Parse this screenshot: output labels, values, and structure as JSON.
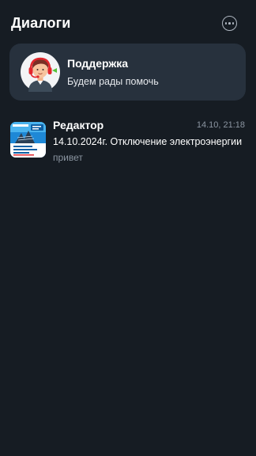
{
  "header": {
    "title": "Диалоги",
    "more_icon": "more-horizontal-circle-icon"
  },
  "support": {
    "title": "Поддержка",
    "subtitle": "Будем рады помочь",
    "avatar_icon": "support-agent-headset-icon"
  },
  "chats": [
    {
      "name": "Редактор",
      "time": "14.10, 21:18",
      "message": "14.10.2024г. Отключение электроэнергии",
      "preview": "привет",
      "avatar_icon": "news-thumbnail-image"
    }
  ],
  "colors": {
    "background": "#161c23",
    "card": "#27313d",
    "muted_text": "#8b95a1",
    "accent_red": "#e2262c",
    "accent_green": "#56c23a"
  }
}
